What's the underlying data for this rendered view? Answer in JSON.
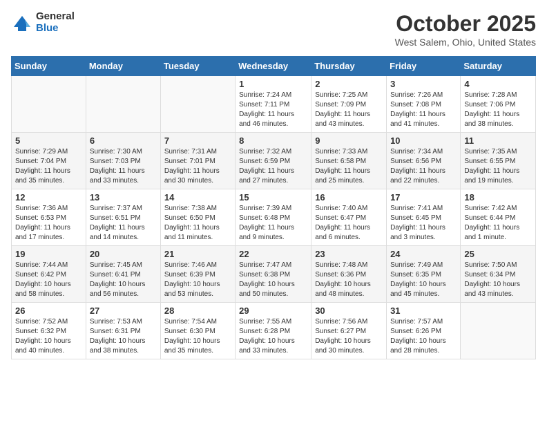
{
  "header": {
    "logo_general": "General",
    "logo_blue": "Blue",
    "month_title": "October 2025",
    "location": "West Salem, Ohio, United States"
  },
  "weekdays": [
    "Sunday",
    "Monday",
    "Tuesday",
    "Wednesday",
    "Thursday",
    "Friday",
    "Saturday"
  ],
  "weeks": [
    [
      {
        "day": "",
        "info": ""
      },
      {
        "day": "",
        "info": ""
      },
      {
        "day": "",
        "info": ""
      },
      {
        "day": "1",
        "info": "Sunrise: 7:24 AM\nSunset: 7:11 PM\nDaylight: 11 hours\nand 46 minutes."
      },
      {
        "day": "2",
        "info": "Sunrise: 7:25 AM\nSunset: 7:09 PM\nDaylight: 11 hours\nand 43 minutes."
      },
      {
        "day": "3",
        "info": "Sunrise: 7:26 AM\nSunset: 7:08 PM\nDaylight: 11 hours\nand 41 minutes."
      },
      {
        "day": "4",
        "info": "Sunrise: 7:28 AM\nSunset: 7:06 PM\nDaylight: 11 hours\nand 38 minutes."
      }
    ],
    [
      {
        "day": "5",
        "info": "Sunrise: 7:29 AM\nSunset: 7:04 PM\nDaylight: 11 hours\nand 35 minutes."
      },
      {
        "day": "6",
        "info": "Sunrise: 7:30 AM\nSunset: 7:03 PM\nDaylight: 11 hours\nand 33 minutes."
      },
      {
        "day": "7",
        "info": "Sunrise: 7:31 AM\nSunset: 7:01 PM\nDaylight: 11 hours\nand 30 minutes."
      },
      {
        "day": "8",
        "info": "Sunrise: 7:32 AM\nSunset: 6:59 PM\nDaylight: 11 hours\nand 27 minutes."
      },
      {
        "day": "9",
        "info": "Sunrise: 7:33 AM\nSunset: 6:58 PM\nDaylight: 11 hours\nand 25 minutes."
      },
      {
        "day": "10",
        "info": "Sunrise: 7:34 AM\nSunset: 6:56 PM\nDaylight: 11 hours\nand 22 minutes."
      },
      {
        "day": "11",
        "info": "Sunrise: 7:35 AM\nSunset: 6:55 PM\nDaylight: 11 hours\nand 19 minutes."
      }
    ],
    [
      {
        "day": "12",
        "info": "Sunrise: 7:36 AM\nSunset: 6:53 PM\nDaylight: 11 hours\nand 17 minutes."
      },
      {
        "day": "13",
        "info": "Sunrise: 7:37 AM\nSunset: 6:51 PM\nDaylight: 11 hours\nand 14 minutes."
      },
      {
        "day": "14",
        "info": "Sunrise: 7:38 AM\nSunset: 6:50 PM\nDaylight: 11 hours\nand 11 minutes."
      },
      {
        "day": "15",
        "info": "Sunrise: 7:39 AM\nSunset: 6:48 PM\nDaylight: 11 hours\nand 9 minutes."
      },
      {
        "day": "16",
        "info": "Sunrise: 7:40 AM\nSunset: 6:47 PM\nDaylight: 11 hours\nand 6 minutes."
      },
      {
        "day": "17",
        "info": "Sunrise: 7:41 AM\nSunset: 6:45 PM\nDaylight: 11 hours\nand 3 minutes."
      },
      {
        "day": "18",
        "info": "Sunrise: 7:42 AM\nSunset: 6:44 PM\nDaylight: 11 hours\nand 1 minute."
      }
    ],
    [
      {
        "day": "19",
        "info": "Sunrise: 7:44 AM\nSunset: 6:42 PM\nDaylight: 10 hours\nand 58 minutes."
      },
      {
        "day": "20",
        "info": "Sunrise: 7:45 AM\nSunset: 6:41 PM\nDaylight: 10 hours\nand 56 minutes."
      },
      {
        "day": "21",
        "info": "Sunrise: 7:46 AM\nSunset: 6:39 PM\nDaylight: 10 hours\nand 53 minutes."
      },
      {
        "day": "22",
        "info": "Sunrise: 7:47 AM\nSunset: 6:38 PM\nDaylight: 10 hours\nand 50 minutes."
      },
      {
        "day": "23",
        "info": "Sunrise: 7:48 AM\nSunset: 6:36 PM\nDaylight: 10 hours\nand 48 minutes."
      },
      {
        "day": "24",
        "info": "Sunrise: 7:49 AM\nSunset: 6:35 PM\nDaylight: 10 hours\nand 45 minutes."
      },
      {
        "day": "25",
        "info": "Sunrise: 7:50 AM\nSunset: 6:34 PM\nDaylight: 10 hours\nand 43 minutes."
      }
    ],
    [
      {
        "day": "26",
        "info": "Sunrise: 7:52 AM\nSunset: 6:32 PM\nDaylight: 10 hours\nand 40 minutes."
      },
      {
        "day": "27",
        "info": "Sunrise: 7:53 AM\nSunset: 6:31 PM\nDaylight: 10 hours\nand 38 minutes."
      },
      {
        "day": "28",
        "info": "Sunrise: 7:54 AM\nSunset: 6:30 PM\nDaylight: 10 hours\nand 35 minutes."
      },
      {
        "day": "29",
        "info": "Sunrise: 7:55 AM\nSunset: 6:28 PM\nDaylight: 10 hours\nand 33 minutes."
      },
      {
        "day": "30",
        "info": "Sunrise: 7:56 AM\nSunset: 6:27 PM\nDaylight: 10 hours\nand 30 minutes."
      },
      {
        "day": "31",
        "info": "Sunrise: 7:57 AM\nSunset: 6:26 PM\nDaylight: 10 hours\nand 28 minutes."
      },
      {
        "day": "",
        "info": ""
      }
    ]
  ]
}
